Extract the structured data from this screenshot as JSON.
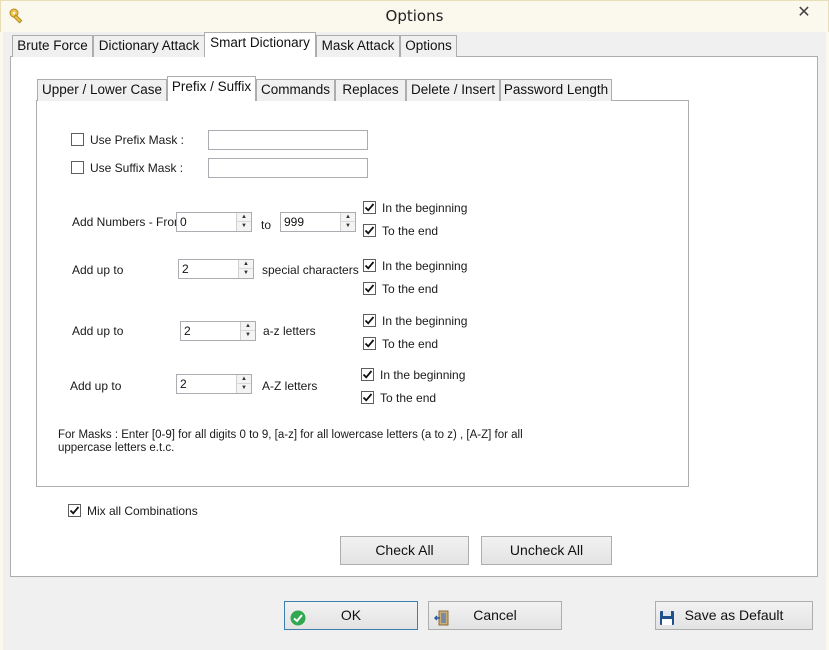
{
  "window": {
    "title": "Options",
    "close_glyph": "✕"
  },
  "main_tabs": [
    "Brute Force",
    "Dictionary Attack",
    "Smart Dictionary",
    "Mask Attack",
    "Options"
  ],
  "sub_tabs": [
    "Upper / Lower Case",
    "Prefix / Suffix",
    "Commands",
    "Replaces",
    "Delete / Insert",
    "Password Length"
  ],
  "prefix": {
    "label": "Use Prefix Mask :",
    "checked": false,
    "value": ""
  },
  "suffix": {
    "label": "Use Suffix Mask :",
    "checked": false,
    "value": ""
  },
  "numbers": {
    "label": "Add Numbers - From",
    "from": "0",
    "to_label": "to",
    "to": "999",
    "begin_label": "In the beginning",
    "begin_checked": true,
    "end_label": "To the end",
    "end_checked": true
  },
  "special": {
    "label": "Add up to",
    "value": "2",
    "suffix": "special characters",
    "begin_label": "In the beginning",
    "begin_checked": true,
    "end_label": "To the end",
    "end_checked": true
  },
  "lower": {
    "label": "Add up to",
    "value": "2",
    "suffix": "a-z letters",
    "begin_label": "In the beginning",
    "begin_checked": true,
    "end_label": "To the end",
    "end_checked": true
  },
  "upper": {
    "label": "Add up to",
    "value": "2",
    "suffix": "A-Z letters",
    "begin_label": "In the beginning",
    "begin_checked": true,
    "end_label": "To the end",
    "end_checked": true
  },
  "mask_help": {
    "line1": "For Masks : Enter [0-9] for all digits 0 to 9, [a-z] for all lowercase  letters (a to z) , [A-Z] for all",
    "line2": "uppercase letters e.t.c."
  },
  "mix": {
    "label": "Mix all Combinations",
    "checked": true
  },
  "buttons": {
    "check_all": "Check All",
    "uncheck_all": "Uncheck All",
    "ok": "OK",
    "cancel": "Cancel",
    "save_default": "Save as Default"
  },
  "icons": {
    "app": "key-icon",
    "ok": "check-circle-icon",
    "cancel": "exit-door-icon",
    "save": "floppy-disk-icon"
  },
  "colors": {
    "ok_icon": "#2fa84f",
    "save_icon": "#1f4f8f",
    "cancel_icon": "#8a6d3b"
  }
}
